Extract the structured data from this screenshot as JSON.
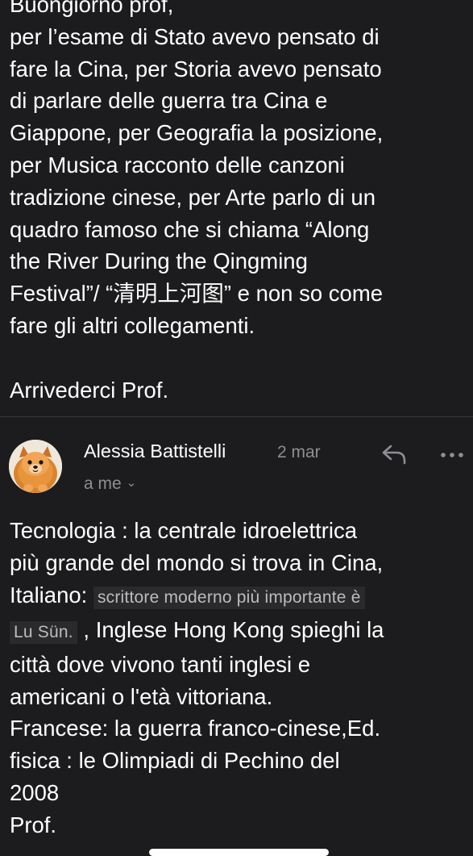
{
  "previous_message": {
    "lines": [
      "Buongiorno prof,",
      "per l’esame di Stato avevo pensato di",
      "fare la Cina, per Storia avevo pensato",
      "di parlare delle guerra tra Cina e",
      "Giappone, per Geografia la posizione,",
      "per Musica racconto delle canzoni",
      "tradizione cinese, per Arte parlo di un",
      "quadro famoso che si chiama “Along",
      "the River During the Qingming",
      "Festival”/ “清明上河图” e non so come",
      "fare gli altri collegamenti."
    ],
    "closing": "Arrivederci Prof."
  },
  "message": {
    "sender": "Alessia Battistelli",
    "date": "2 mar",
    "recipient": "a me",
    "avatar_icon": "pomeranian-dog-avatar",
    "reply_icon": "reply-arrow-icon",
    "more_icon": "more-dots-icon",
    "body": {
      "line1": "Tecnologia : la centrale idroelettrica",
      "line2": "più grande del mondo si trova in Cina,",
      "line3_a": "Italiano: ",
      "line3_hl": "scrittore moderno più importante è",
      "line4_hl": "Lu Sün.",
      "line4_b": " , Inglese  Hong Kong spieghi la",
      "line5": "città dove vivono tanti inglesi e",
      "line6": "americani  o l'età vittoriana.",
      "line7": "Francese: la guerra franco-cinese,Ed.",
      "line8": "fisica : le Olimpiadi di Pechino del",
      "line9": "2008",
      "line10": "Prof."
    }
  },
  "colors": {
    "background": "#1c1c1e",
    "text": "#ffffff",
    "secondary_text": "#8e8e93",
    "divider": "#3a3a3c"
  }
}
